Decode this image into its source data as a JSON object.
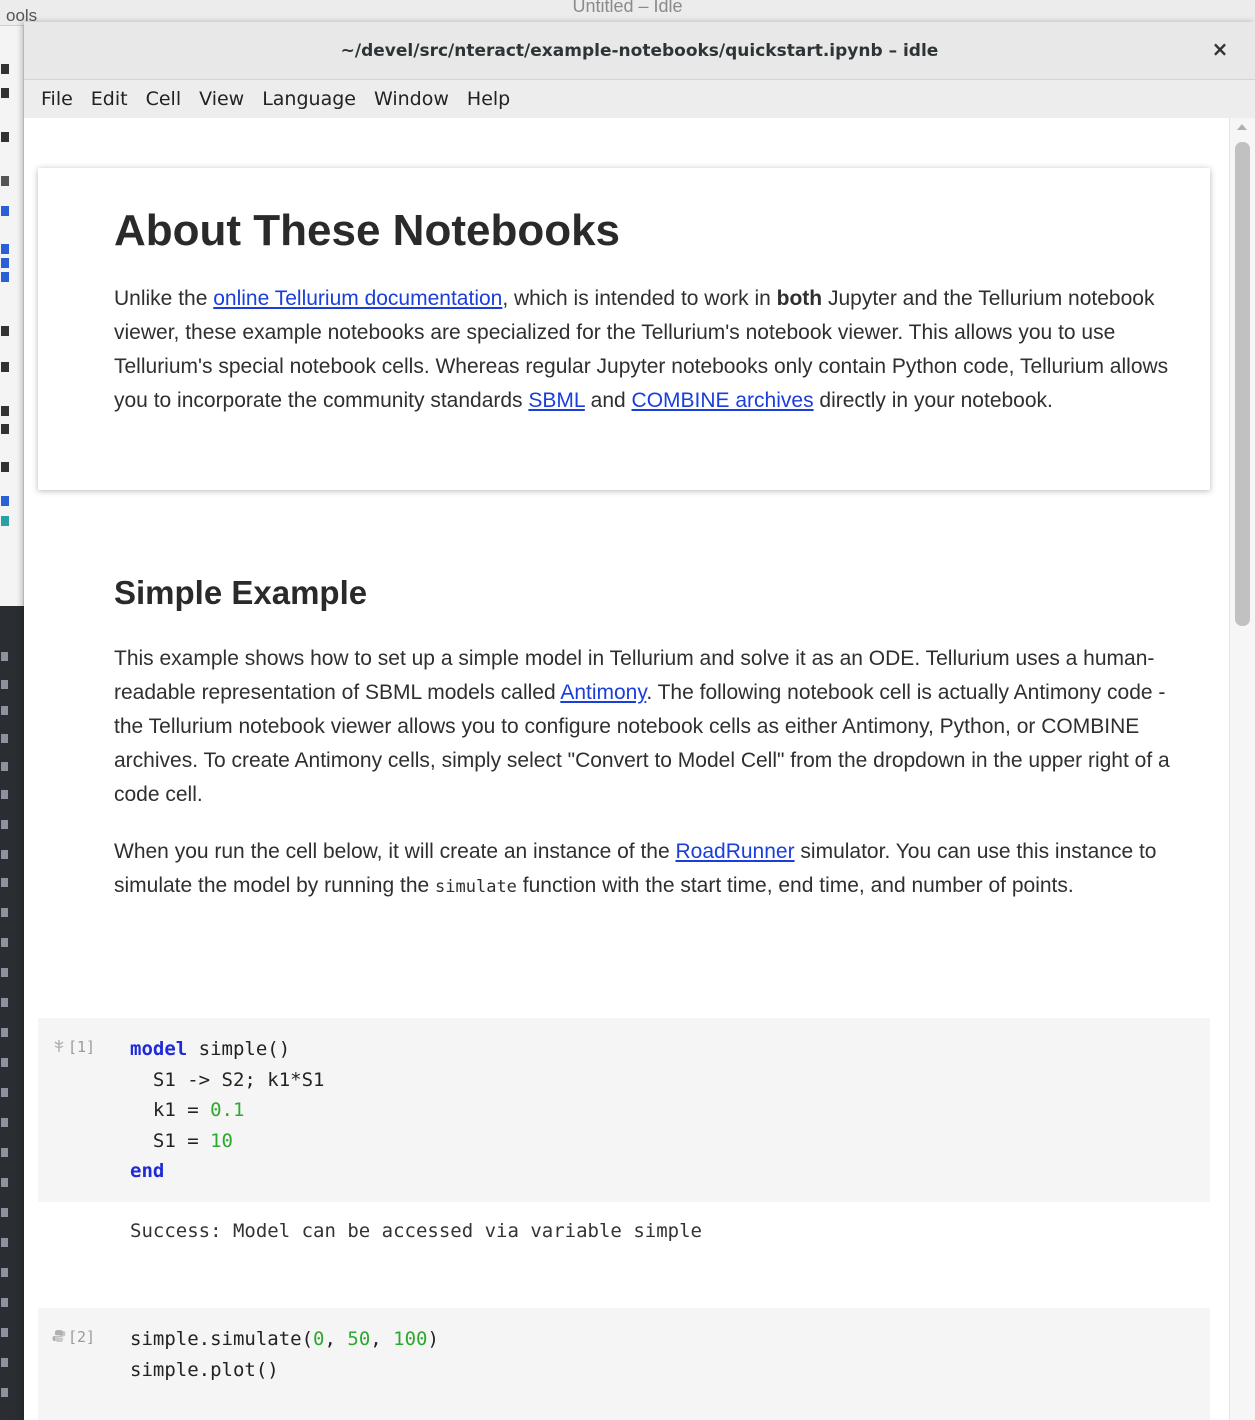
{
  "background": {
    "window_title": "Untitled – Idle",
    "menu_fragment": "ools"
  },
  "window": {
    "title": "~/devel/src/nteract/example-notebooks/quickstart.ipynb – idle",
    "close_glyph": "×"
  },
  "menu": [
    "File",
    "Edit",
    "Cell",
    "View",
    "Language",
    "Window",
    "Help"
  ],
  "markdown_cell_1": {
    "heading": "About These Notebooks",
    "p1_a": "Unlike the ",
    "p1_link1": "online Tellurium documentation",
    "p1_b": ", which is intended to work in ",
    "p1_bold": "both",
    "p1_c": " Jupyter and the Tellurium notebook viewer, these example notebooks are specialized for the Tellurium's notebook viewer. This allows you to use Tellurium's special notebook cells. Whereas regular Jupyter notebooks only contain Python code, Tellurium allows you to incorporate the community standards ",
    "p1_link2": "SBML",
    "p1_d": " and ",
    "p1_link3": "COMBINE archives",
    "p1_e": " directly in your notebook."
  },
  "markdown_cell_2": {
    "heading": "Simple Example",
    "p1_a": "This example shows how to set up a simple model in Tellurium and solve it as an ODE. Tellurium uses a human-readable representation of SBML models called ",
    "p1_link": "Antimony",
    "p1_b": ". The following notebook cell is actually Antimony code - the Tellurium notebook viewer allows you to configure notebook cells as either Antimony, Python, or COMBINE archives. To create Antimony cells, simply select \"Convert to Model Cell\" from the dropdown in the upper right of a code cell.",
    "p2_a": "When you run the cell below, it will create an instance of the ",
    "p2_link": "RoadRunner",
    "p2_b": " simulator. You can use this instance to simulate the model by running the ",
    "p2_code": "simulate",
    "p2_c": " function with the start time, end time, and number of points."
  },
  "code_cell_1": {
    "prompt": "[1]",
    "icon": "antimony-icon",
    "lines": {
      "l1_kw": "model",
      "l1_rest": " simple()",
      "l2": "  S1 -> S2; k1*S1",
      "l3_a": "  k1 = ",
      "l3_num": "0.1",
      "l4_a": "  S1 = ",
      "l4_num": "10",
      "l5_kw": "end"
    },
    "output": "Success: Model can be accessed via variable simple"
  },
  "code_cell_2": {
    "prompt": "[2]",
    "icon": "python-icon",
    "lines": {
      "l1_a": "simple.simulate(",
      "l1_n1": "0",
      "l1_s1": ", ",
      "l1_n2": "50",
      "l1_s2": ", ",
      "l1_n3": "100",
      "l1_end": ")",
      "l2": "simple.plot()"
    }
  }
}
